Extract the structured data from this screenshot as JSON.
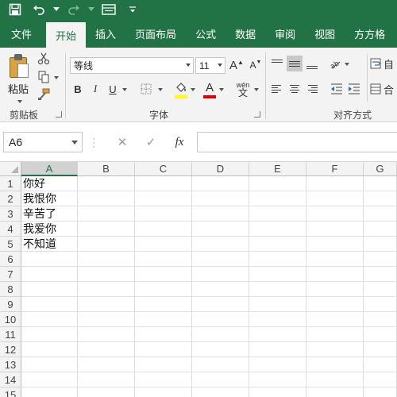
{
  "quick_access": {
    "icons": [
      "save-icon",
      "undo-icon",
      "redo-icon",
      "form-icon",
      "customize-icon"
    ]
  },
  "tabs": [
    {
      "label": "文件",
      "active": false
    },
    {
      "label": "开始",
      "active": true
    },
    {
      "label": "插入",
      "active": false
    },
    {
      "label": "页面布局",
      "active": false
    },
    {
      "label": "公式",
      "active": false
    },
    {
      "label": "数据",
      "active": false
    },
    {
      "label": "审阅",
      "active": false
    },
    {
      "label": "视图",
      "active": false
    },
    {
      "label": "方方格",
      "active": false
    }
  ],
  "ribbon": {
    "clipboard": {
      "paste_label": "粘贴",
      "group_label": "剪贴板"
    },
    "font": {
      "font_name": "等线",
      "font_size": "11",
      "grow_label": "A",
      "shrink_label": "A",
      "bold": "B",
      "italic": "I",
      "underline": "U",
      "font_color_label": "A",
      "phonetic_label": "wén",
      "phonetic_char": "文",
      "group_label": "字体",
      "highlight_color": "#ffff00",
      "font_color": "#e00000"
    },
    "alignment": {
      "group_label": "对齐方式",
      "wrap_label": "自",
      "merge_label": "合"
    }
  },
  "formula_bar": {
    "name_box": "A6",
    "cancel": "✕",
    "confirm": "✓",
    "fx": "fx",
    "formula": ""
  },
  "grid": {
    "columns": [
      "A",
      "B",
      "C",
      "D",
      "E",
      "F",
      "G"
    ],
    "selected_column": "A",
    "rows": [
      "1",
      "2",
      "3",
      "4",
      "5",
      "6",
      "7",
      "8",
      "9",
      "10",
      "11",
      "12",
      "13",
      "14",
      "15"
    ],
    "cells": {
      "A1": "你好",
      "A2": "我恨你",
      "A3": "辛苦了",
      "A4": "我爱你",
      "A5": "不知道"
    }
  },
  "colors": {
    "accent": "#217346",
    "ribbon_bg": "#f3f3f3"
  }
}
